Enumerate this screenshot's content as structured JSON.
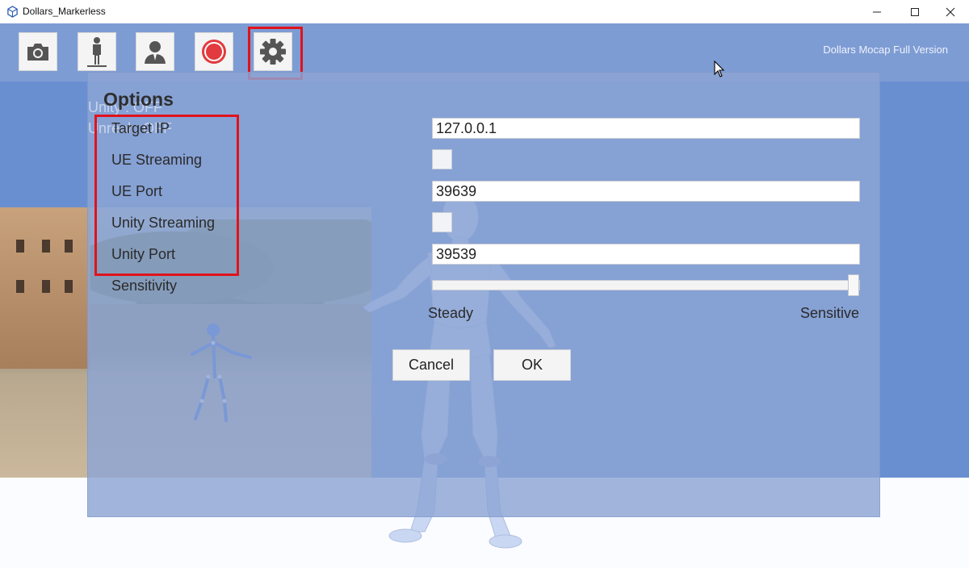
{
  "window": {
    "title": "Dollars_Markerless",
    "icon": "app-cube-icon"
  },
  "toolbar": {
    "buttons": [
      {
        "name": "camera",
        "icon": "camera-icon"
      },
      {
        "name": "standing",
        "icon": "standing-person-icon"
      },
      {
        "name": "avatar",
        "icon": "person-bust-icon"
      },
      {
        "name": "record",
        "icon": "record-icon"
      },
      {
        "name": "settings",
        "icon": "gear-icon"
      }
    ],
    "version_label": "Dollars Mocap Full Version"
  },
  "status_ghost": {
    "line1": "Unity   : OFF",
    "line2": "Unreal : OFF"
  },
  "options": {
    "title": "Options",
    "target_ip_label": "Target IP",
    "target_ip_value": "127.0.0.1",
    "ue_streaming_label": "UE Streaming",
    "ue_streaming_checked": false,
    "ue_port_label": "UE Port",
    "ue_port_value": "39639",
    "unity_streaming_label": "Unity Streaming",
    "unity_streaming_checked": false,
    "unity_port_label": "Unity Port",
    "unity_port_value": "39539",
    "sensitivity_label": "Sensitivity",
    "sensitivity_value": 1.0,
    "sensitivity_min_label": "Steady",
    "sensitivity_max_label": "Sensitive",
    "cancel_label": "Cancel",
    "ok_label": "OK"
  },
  "colors": {
    "highlight": "#e0131b",
    "background_blue": "#6a8fd1",
    "panel": "#8ca5d4"
  }
}
